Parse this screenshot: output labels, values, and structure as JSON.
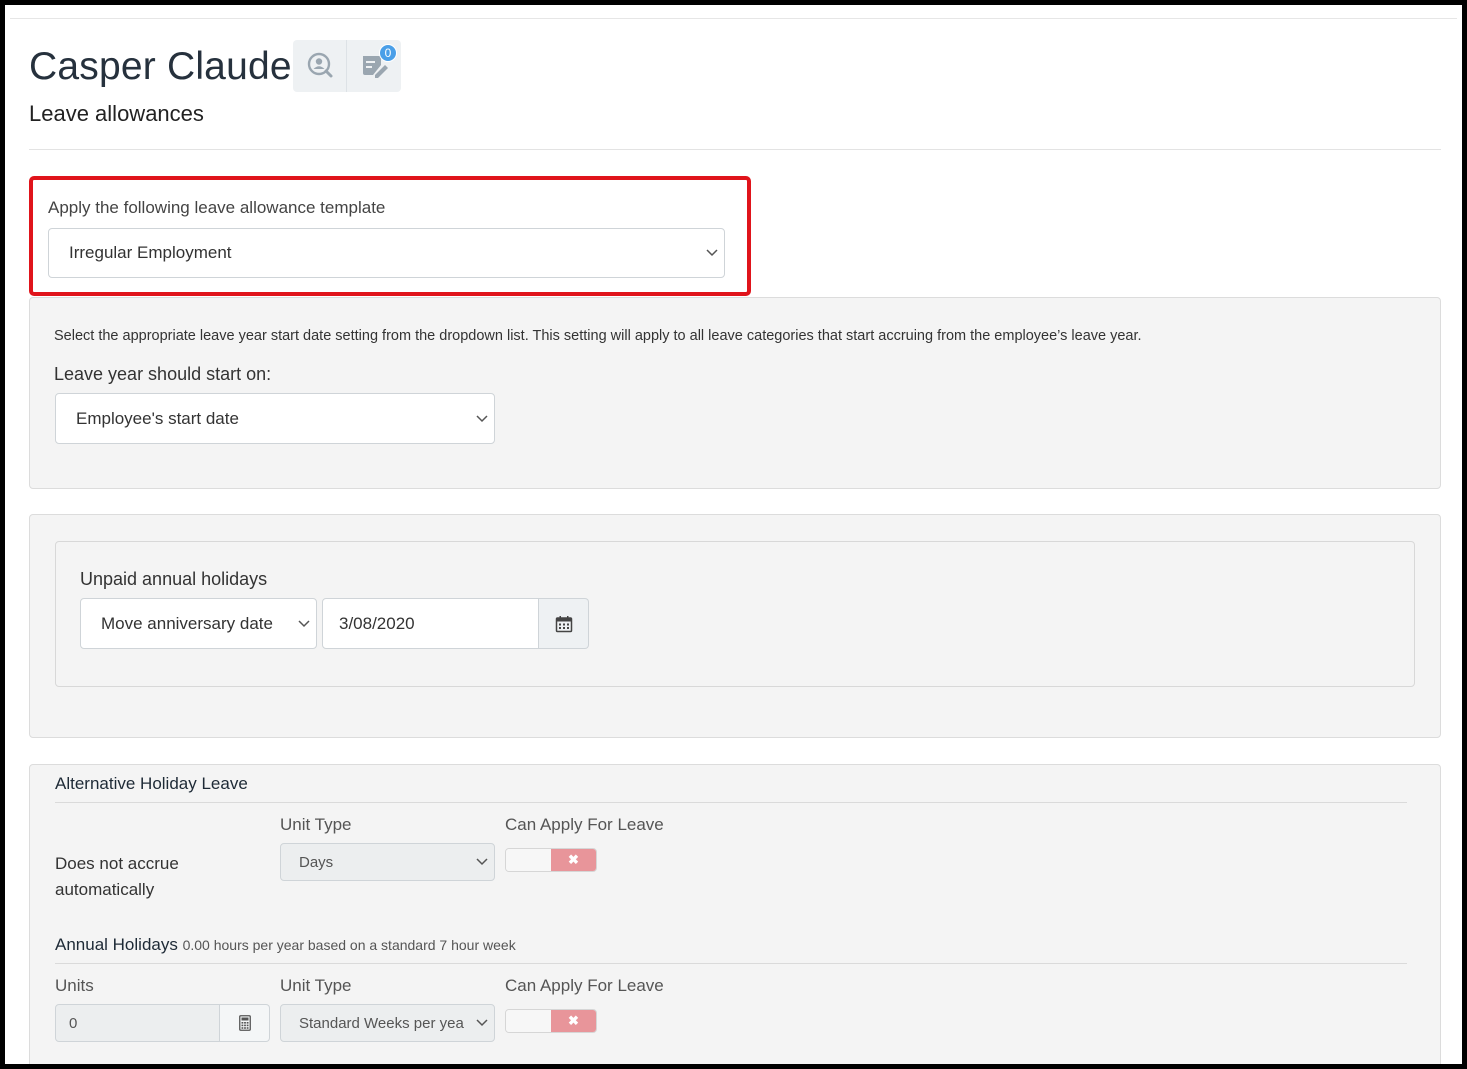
{
  "header": {
    "employee_name": "Casper Claude",
    "page_subtitle": "Leave allowances",
    "notes_badge_count": "0",
    "icons": [
      "search-person-icon",
      "notes-icon"
    ]
  },
  "template_section": {
    "label": "Apply the following leave allowance template",
    "selected_template": "Irregular Employment",
    "highlight_color": "#e0141b"
  },
  "leave_year": {
    "help_text": "Select the appropriate leave year start date setting from the dropdown list. This setting will apply to all leave categories that start accruing from the employee’s leave year.",
    "label": "Leave year should start on:",
    "selected": "Employee's start date"
  },
  "unpaid_holidays": {
    "title": "Unpaid annual holidays",
    "action_selected": "Move anniversary date",
    "date_value": "3/08/2020"
  },
  "alternative_holiday": {
    "title": "Alternative Holiday Leave",
    "unit_type_label": "Unit Type",
    "can_apply_label": "Can Apply For Leave",
    "accrual_text": "Does not accrue automatically",
    "unit_type_selected": "Days",
    "can_apply_toggle": "✖"
  },
  "annual_holidays": {
    "title": "Annual Holidays",
    "subtitle": "0.00 hours per year based on a standard 7 hour week",
    "units_label": "Units",
    "unit_type_label": "Unit Type",
    "can_apply_label": "Can Apply For Leave",
    "units_value": "0",
    "unit_type_selected": "Standard Weeks per yea",
    "can_apply_toggle": "✖"
  }
}
